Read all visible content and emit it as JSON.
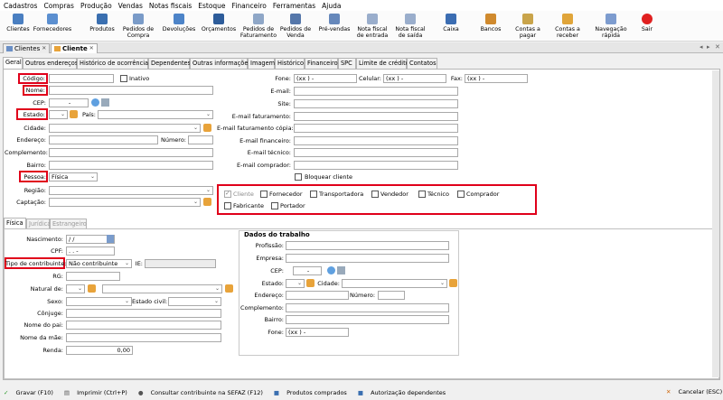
{
  "menu": [
    "Cadastros",
    "Compras",
    "Produção",
    "Vendas",
    "Notas fiscais",
    "Estoque",
    "Financeiro",
    "Ferramentas",
    "Ajuda"
  ],
  "toolbar": {
    "clientes": "Clientes",
    "fornecedores": "Fornecedores",
    "produtos": "Produtos",
    "pedidos_compra_1": "Pedidos de",
    "pedidos_compra_2": "Compra",
    "devolucoes": "Devoluções",
    "orcamentos": "Orçamentos",
    "pedidos_fat_1": "Pedidos de",
    "pedidos_fat_2": "Faturamento",
    "pedidos_venda_1": "Pedidos de",
    "pedidos_venda_2": "Venda",
    "pre_vendas": "Pré-vendas",
    "nf_entrada_1": "Nota fiscal",
    "nf_entrada_2": "de entrada",
    "nf_saida_1": "Nota fiscal",
    "nf_saida_2": "de saída",
    "caixa": "Caixa",
    "bancos": "Bancos",
    "contas_pagar_1": "Contas a",
    "contas_pagar_2": "pagar",
    "contas_receber_1": "Contas a",
    "contas_receber_2": "receber",
    "navegacao_1": "Navegação",
    "navegacao_2": "rápida",
    "sair": "Sair"
  },
  "doc_tabs": {
    "clientes": "Clientes",
    "cliente": "Cliente"
  },
  "form_tabs": [
    "Geral",
    "Outros endereços",
    "Histórico de ocorrências",
    "Dependentes",
    "Outras informações",
    "Imagem",
    "Histórico",
    "Financeiro",
    "SPC",
    "Limite de crédito",
    "Contatos"
  ],
  "left": {
    "codigo": "Código:",
    "inativo": "Inativo",
    "nome": "Nome:",
    "cep": "CEP:",
    "cep_value": "-",
    "estado": "Estado:",
    "pais": "País:",
    "cidade": "Cidade:",
    "endereco": "Endereço:",
    "numero": "Número:",
    "complemento": "Complemento:",
    "bairro": "Bairro:",
    "pessoa": "Pessoa:",
    "pessoa_value": "Física",
    "regiao": "Região:",
    "captacao": "Captação:"
  },
  "right": {
    "fone": "Fone:",
    "fone_value": "(xx )   -",
    "celular": "Celular:",
    "celular_value": "(xx )   -",
    "fax": "Fax:",
    "fax_value": "(xx )   -",
    "email": "E-mail:",
    "site": "Site:",
    "email_fat": "E-mail faturamento:",
    "email_fat_copia": "E-mail faturamento cópia:",
    "email_fin": "E-mail financeiro:",
    "email_tec": "E-mail técnico:",
    "email_comp": "E-mail comprador:",
    "bloquear": "Bloquear cliente"
  },
  "roles": [
    "Cliente",
    "Fornecedor",
    "Transportadora",
    "Vendedor",
    "Técnico",
    "Comprador",
    "Fabricante",
    "Portador"
  ],
  "sub_tabs": [
    "Física",
    "Jurídica",
    "Estrangeiro"
  ],
  "fisica": {
    "nascimento": "Nascimento:",
    "nascimento_value": "/ /",
    "cpf": "CPF:",
    "cpf_value": ". . -",
    "tipo_contrib": "Tipo de contribuinte:",
    "tipo_contrib_value": "Não contribuinte",
    "ie": "IE:",
    "rg": "RG:",
    "natural": "Natural de:",
    "sexo": "Sexo:",
    "estado_civil": "Estado civil:",
    "conjuge": "Cônjuge:",
    "nome_pai": "Nome do pai:",
    "nome_mae": "Nome da mãe:",
    "renda": "Renda:",
    "renda_value": "0,00"
  },
  "trabalho": {
    "title": "Dados do trabalho",
    "profissao": "Profissão:",
    "empresa": "Empresa:",
    "cep": "CEP:",
    "cep_value": "-",
    "estado": "Estado:",
    "cidade": "Cidade:",
    "endereco": "Endereço:",
    "numero": "Número:",
    "complemento": "Complemento:",
    "bairro": "Bairro:",
    "fone": "Fone:",
    "fone_value": "(xx )   -"
  },
  "status": {
    "gravar": "Gravar (F10)",
    "imprimir": "Imprimir (Ctrl+P)",
    "consultar": "Consultar contribuinte na SEFAZ (F12)",
    "produtos": "Produtos comprados",
    "autorizacao": "Autorização dependentes",
    "cancelar": "Cancelar (ESC)"
  },
  "colors": {
    "highlight": "#e0001a",
    "accent": "#e8a33a"
  }
}
